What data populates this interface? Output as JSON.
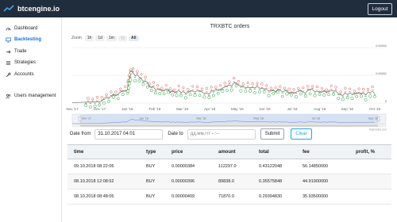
{
  "app": {
    "logo_text": "btcengine.io",
    "logout_label": "Logout"
  },
  "sidebar": {
    "items": [
      {
        "label": "Dashboard",
        "icon": "speedometer-icon",
        "active": false
      },
      {
        "label": "Backtesting",
        "icon": "monitor-icon",
        "active": true
      },
      {
        "label": "Trade",
        "icon": "arrow-right-icon",
        "active": false
      },
      {
        "label": "Strategies",
        "icon": "list-icon",
        "active": false
      },
      {
        "label": "Accounts",
        "icon": "wrench-icon",
        "active": false
      },
      {
        "label": "Users management",
        "icon": "users-icon",
        "active": false
      }
    ]
  },
  "chart": {
    "title": "TRXBTC orders",
    "zoom_label": "Zoom",
    "zoom_buttons": [
      "1h",
      "1d",
      "1m",
      "1y",
      "All"
    ],
    "zoom_disabled": "1y",
    "zoom_selected": "All",
    "x_ticks": [
      "Nov '17",
      "Dec '17",
      "Jan '18",
      "Feb '18",
      "Mar '18",
      "Apr '18",
      "May '18",
      "Jun '18",
      "Jul '18",
      "Aug '18",
      "Sep '18",
      "Oct '18"
    ],
    "y_ticks": [
      "0.00002",
      "0.00001",
      "0"
    ],
    "navigator_ticks": [
      "Nov '17",
      "Jan '18",
      "Mar '18",
      "May '18",
      "Jul '18",
      "Sep '18"
    ],
    "credit": "Highcharts.com",
    "colors": {
      "buy": "#2e9d44",
      "sell": "#d9534f",
      "line": "#555555",
      "navigator": "#c5d3ee"
    }
  },
  "chart_data": {
    "type": "line",
    "title": "TRXBTC orders",
    "x": [
      "2017-11-01",
      "2017-12-01",
      "2018-01-01",
      "2018-01-05",
      "2018-02-01",
      "2018-03-01",
      "2018-04-01",
      "2018-05-01",
      "2018-06-01",
      "2018-07-01",
      "2018-08-01",
      "2018-09-01",
      "2018-10-01"
    ],
    "series": [
      {
        "values": [
          2e-07,
          4e-07,
          5e-06,
          1.15e-05,
          4.8e-06,
          4e-06,
          3.8e-06,
          7e-06,
          4.8e-06,
          4e-06,
          4.5e-06,
          3e-06,
          3.5e-06
        ]
      }
    ],
    "ylim": [
      0,
      2e-05
    ],
    "markers": [
      "buy",
      "sell"
    ]
  },
  "filters": {
    "date_from_label": "Date from",
    "date_from_value": "31.10.2017 04:01",
    "date_to_label": "Date to",
    "date_to_placeholder": "дд.мм.ггг --:--",
    "submit_label": "Submit",
    "clear_label": "Clear"
  },
  "table": {
    "columns": [
      "time",
      "type",
      "price",
      "amount",
      "total",
      "fee",
      "profit, %"
    ],
    "rows": [
      [
        "09.10.2018 08:22:05",
        "BUY",
        "0.00000384",
        "112297.0",
        "0.43122048",
        "56.14850000",
        ""
      ],
      [
        "08.10.2018 12:08:52",
        "BUY",
        "0.00000396",
        "89838.0",
        "0.35575848",
        "44.91900000",
        ""
      ],
      [
        "08.10.2018 08:48:05",
        "BUY",
        "0.00000409",
        "71870.0",
        "0.29394830",
        "35.93500000",
        ""
      ]
    ]
  }
}
